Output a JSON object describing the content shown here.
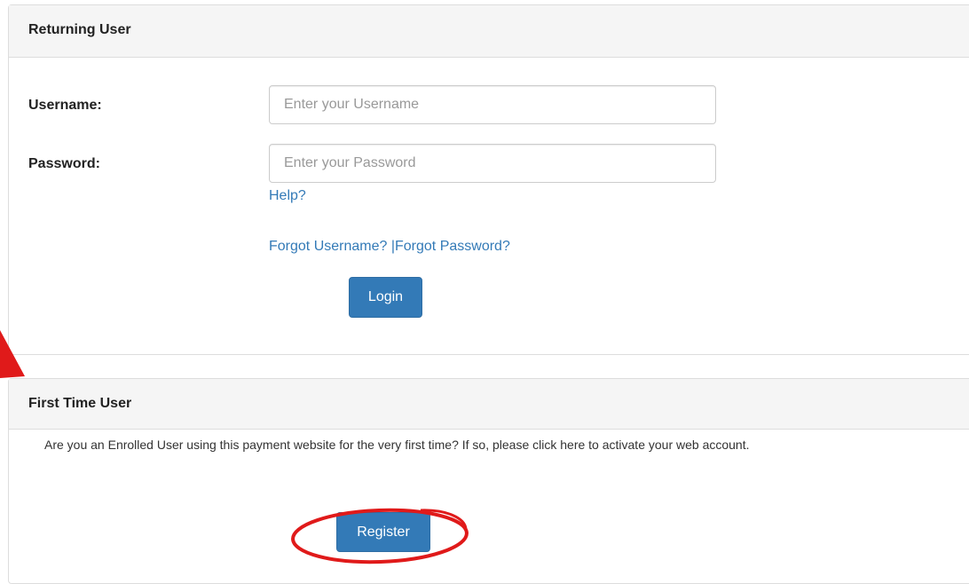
{
  "returning_user": {
    "heading": "Returning User",
    "username_label": "Username:",
    "username_placeholder": "Enter your Username",
    "password_label": "Password:",
    "password_placeholder": "Enter your Password",
    "help_link": "Help?",
    "forgot_username_link": "Forgot Username?",
    "separator": "|",
    "forgot_password_link": "Forgot Password?",
    "login_button": "Login"
  },
  "first_time_user": {
    "heading": "First Time User",
    "info_text": "Are you an Enrolled User using this payment website for the very first time? If so, please click here to activate your web account.",
    "register_button": "Register"
  },
  "annotations": {
    "highlight_color": "#e01a1a",
    "arrow_icon": "red-arrow-icon",
    "circle_icon": "red-circle-highlight-icon"
  },
  "colors": {
    "link": "#337ab7",
    "button_primary": "#337ab7",
    "panel_heading_bg": "#f5f5f5",
    "border": "#dddddd"
  }
}
